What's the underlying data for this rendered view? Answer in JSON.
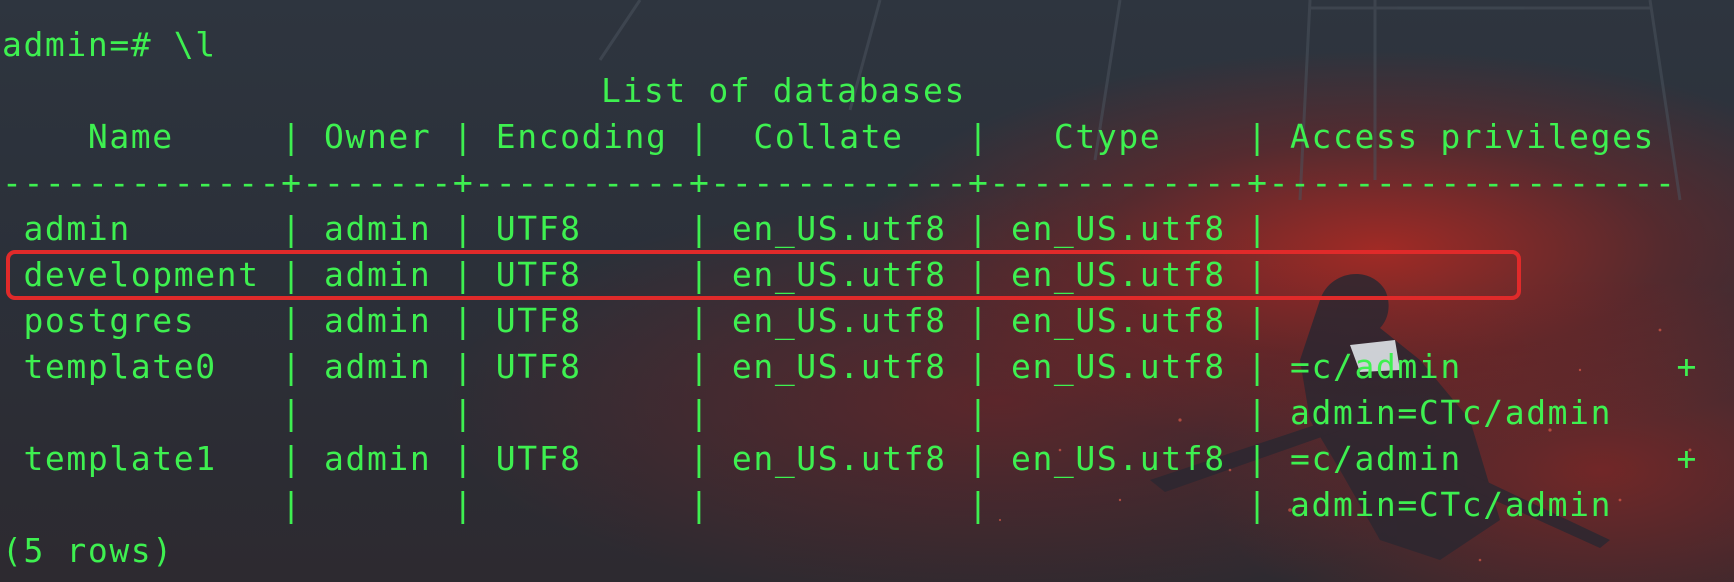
{
  "terminal": {
    "prompt": "admin=# \\l",
    "title": "List of databases",
    "header": "    Name     | Owner | Encoding |  Collate   |   Ctype    | Access privileges",
    "separator": "-------------+-------+----------+------------+------------+-------------------",
    "rows": [
      " admin       | admin | UTF8     | en_US.utf8 | en_US.utf8 |",
      " development | admin | UTF8     | en_US.utf8 | en_US.utf8 |",
      " postgres    | admin | UTF8     | en_US.utf8 | en_US.utf8 |",
      " template0   | admin | UTF8     | en_US.utf8 | en_US.utf8 | =c/admin          +",
      "             |       |          |            |            | admin=CTc/admin",
      " template1   | admin | UTF8     | en_US.utf8 | en_US.utf8 | =c/admin          +",
      "             |       |          |            |            | admin=CTc/admin"
    ],
    "footer": "(5 rows)",
    "highlighted_row": "development"
  },
  "colors": {
    "text": "#3ef050",
    "highlight_border": "#e02a2a",
    "background": "#2b323c"
  }
}
